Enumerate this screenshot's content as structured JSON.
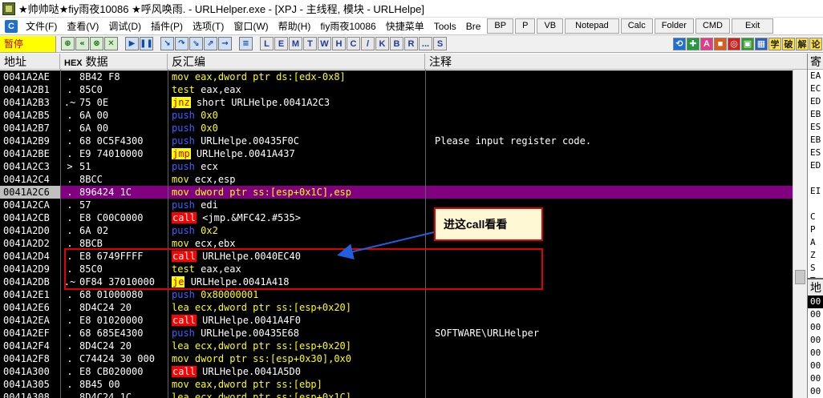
{
  "window": {
    "title": "★帅帅哒★fiy雨夜10086  ★呼风唤雨. - URLHelper.exe - [XPJ - 主线程, 模块 - URLHelpe]"
  },
  "menu": {
    "items": [
      "文件(F)",
      "查看(V)",
      "调试(D)",
      "插件(P)",
      "选项(T)",
      "窗口(W)",
      "帮助(H)",
      "fiy雨夜10086",
      "快捷菜单",
      "Tools",
      "Bre"
    ],
    "buttons": [
      "BP",
      "P",
      "VB",
      "Notepad",
      "Calc",
      "Folder",
      "CMD",
      "Exit"
    ]
  },
  "toolbar": {
    "status": "暂停",
    "letters": [
      "L",
      "E",
      "M",
      "T",
      "W",
      "H",
      "C",
      "/",
      "K",
      "B",
      "R",
      "...",
      "S"
    ],
    "right_text": [
      "学",
      "破",
      "解",
      "论"
    ]
  },
  "columns": {
    "address": "地址",
    "hex_tag": "HEX",
    "data": "数据",
    "disasm": "反汇编",
    "comment": "注释"
  },
  "rows": [
    {
      "addr": "0041A2AE",
      "mark": ".",
      "bytes": "8B42 F8",
      "mn": "mov",
      "ops": "eax,dword ptr ds:[edx-0x8]",
      "type": "mov",
      "comment": ""
    },
    {
      "addr": "0041A2B1",
      "mark": ".",
      "bytes": "85C0",
      "mn": "test",
      "ops": "eax,eax",
      "type": "plain",
      "comment": ""
    },
    {
      "addr": "0041A2B3",
      "mark": ".~",
      "bytes": "75 0E",
      "mn": "jnz",
      "ops": "short URLHelpe.0041A2C3",
      "type": "jmp",
      "comment": ""
    },
    {
      "addr": "0041A2B5",
      "mark": ".",
      "bytes": "6A 00",
      "mn": "push",
      "ops": "0x0",
      "type": "push",
      "comment": ""
    },
    {
      "addr": "0041A2B7",
      "mark": ".",
      "bytes": "6A 00",
      "mn": "push",
      "ops": "0x0",
      "type": "push",
      "comment": ""
    },
    {
      "addr": "0041A2B9",
      "mark": ".",
      "bytes": "68 0C5F4300",
      "mn": "push",
      "ops": "URLHelpe.00435F0C",
      "type": "push",
      "comment": "Please input register code."
    },
    {
      "addr": "0041A2BE",
      "mark": ".",
      "bytes": "E9 74010000",
      "mn": "jmp",
      "ops": "URLHelpe.0041A437",
      "type": "jmp",
      "comment": ""
    },
    {
      "addr": "0041A2C3",
      "mark": ">",
      "bytes": "51",
      "mn": "push",
      "ops": "ecx",
      "type": "push",
      "comment": ""
    },
    {
      "addr": "0041A2C4",
      "mark": ".",
      "bytes": "8BCC",
      "mn": "mov",
      "ops": "ecx,esp",
      "type": "plain",
      "comment": ""
    },
    {
      "addr": "0041A2C6",
      "mark": ".",
      "bytes": "896424 1C",
      "mn": "mov",
      "ops": "dword ptr ss:[esp+0x1C],esp",
      "type": "mov",
      "comment": "",
      "selected": true
    },
    {
      "addr": "0041A2CA",
      "mark": ".",
      "bytes": "57",
      "mn": "push",
      "ops": "edi",
      "type": "push",
      "comment": ""
    },
    {
      "addr": "0041A2CB",
      "mark": ".",
      "bytes": "E8 C00C0000",
      "mn": "call",
      "ops": "<jmp.&MFC42.#535>",
      "type": "call",
      "comment": ""
    },
    {
      "addr": "0041A2D0",
      "mark": ".",
      "bytes": "6A 02",
      "mn": "push",
      "ops": "0x2",
      "type": "push",
      "comment": ""
    },
    {
      "addr": "0041A2D2",
      "mark": ".",
      "bytes": "8BCB",
      "mn": "mov",
      "ops": "ecx,ebx",
      "type": "plain",
      "comment": ""
    },
    {
      "addr": "0041A2D4",
      "mark": ".",
      "bytes": "E8 6749FFFF",
      "mn": "call",
      "ops": "URLHelpe.0040EC40",
      "type": "call",
      "comment": ""
    },
    {
      "addr": "0041A2D9",
      "mark": ".",
      "bytes": "85C0",
      "mn": "test",
      "ops": "eax,eax",
      "type": "plain",
      "comment": ""
    },
    {
      "addr": "0041A2DB",
      "mark": ".~",
      "bytes": "0F84 37010000",
      "mn": "je",
      "ops": "URLHelpe.0041A418",
      "type": "jmp",
      "comment": ""
    },
    {
      "addr": "0041A2E1",
      "mark": ".",
      "bytes": "68 01000080",
      "mn": "push",
      "ops": "0x80000001",
      "type": "push",
      "comment": ""
    },
    {
      "addr": "0041A2E6",
      "mark": ".",
      "bytes": "8D4C24 20",
      "mn": "lea",
      "ops": "ecx,dword ptr ss:[esp+0x20]",
      "type": "mov",
      "comment": ""
    },
    {
      "addr": "0041A2EA",
      "mark": ".",
      "bytes": "E8 01020000",
      "mn": "call",
      "ops": "URLHelpe.0041A4F0",
      "type": "call",
      "comment": ""
    },
    {
      "addr": "0041A2EF",
      "mark": ".",
      "bytes": "68 685E4300",
      "mn": "push",
      "ops": "URLHelpe.00435E68",
      "type": "push",
      "comment": "SOFTWARE\\URLHelper"
    },
    {
      "addr": "0041A2F4",
      "mark": ".",
      "bytes": "8D4C24 20",
      "mn": "lea",
      "ops": "ecx,dword ptr ss:[esp+0x20]",
      "type": "mov",
      "comment": ""
    },
    {
      "addr": "0041A2F8",
      "mark": ".",
      "bytes": "C74424 30 000",
      "mn": "mov",
      "ops": "dword ptr ss:[esp+0x30],0x0",
      "type": "mov",
      "comment": ""
    },
    {
      "addr": "0041A300",
      "mark": ".",
      "bytes": "E8 CB020000",
      "mn": "call",
      "ops": "URLHelpe.0041A5D0",
      "type": "call",
      "comment": ""
    },
    {
      "addr": "0041A305",
      "mark": ".",
      "bytes": "8B45 00",
      "mn": "mov",
      "ops": "eax,dword ptr ss:[ebp]",
      "type": "mov",
      "comment": ""
    },
    {
      "addr": "0041A308",
      "mark": ".",
      "bytes": "8D4C24 1C",
      "mn": "lea",
      "ops": "ecx,dword ptr ss:[esp+0x1C]",
      "type": "mov",
      "comment": ""
    }
  ],
  "annotation": {
    "text": "进这call看看"
  },
  "registers": {
    "header": "寄",
    "names": [
      "EA",
      "EC",
      "ED",
      "EB",
      "ES",
      "EB",
      "ES",
      "ED",
      "",
      "EI",
      "",
      "C",
      "P",
      "A",
      "Z",
      "S",
      "T"
    ]
  },
  "dump": {
    "header": "地",
    "rows": [
      "00",
      "00",
      "00",
      "00",
      "00",
      "00",
      "00",
      "00"
    ]
  }
}
